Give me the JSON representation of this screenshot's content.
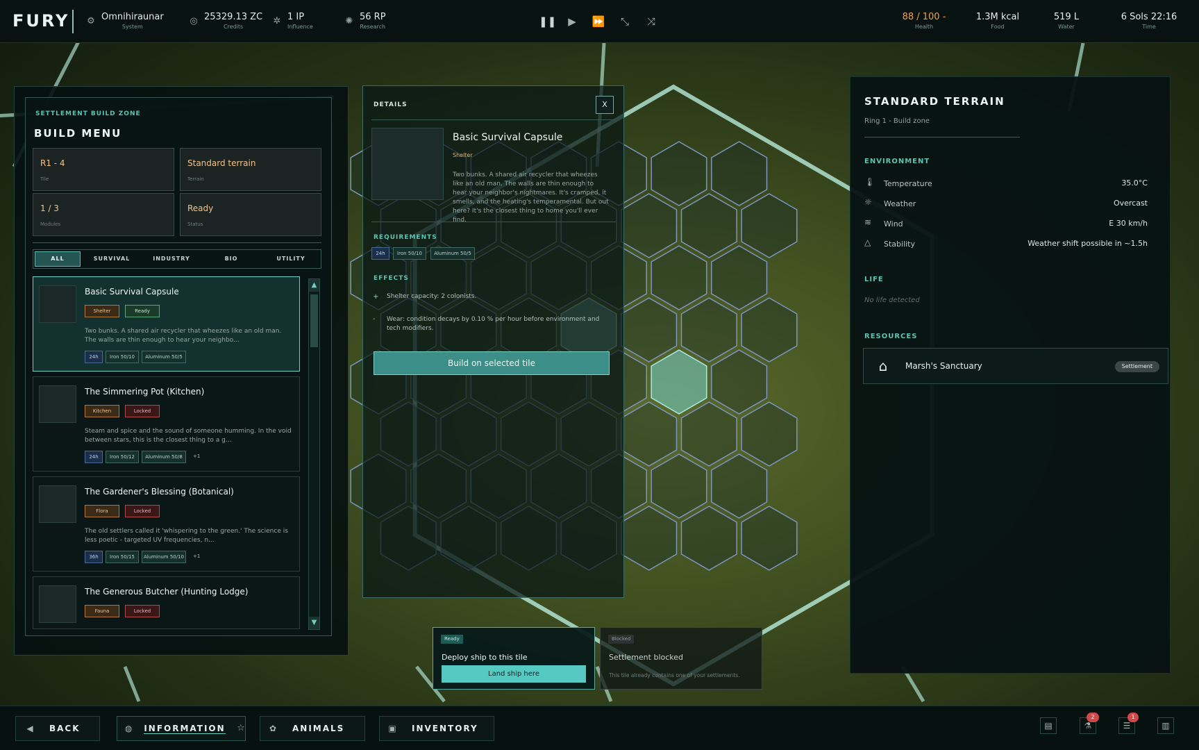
{
  "topbar": {
    "logo": "FURY",
    "stats": [
      {
        "icon": "system-icon",
        "value": "Omnihiraunar",
        "label": "System"
      },
      {
        "icon": "credits-icon",
        "value": "25329.13 ZC",
        "label": "Credits"
      },
      {
        "icon": "influence-icon",
        "value": "1 IP",
        "label": "Influence"
      },
      {
        "icon": "research-icon",
        "value": "56 RP",
        "label": "Research"
      }
    ],
    "resources": [
      {
        "value": "88 / 100 -",
        "label": "Health",
        "color": "#f0a34a"
      },
      {
        "value": "1.3M kcal",
        "label": "Food",
        "color": "#e6efec"
      },
      {
        "value": "519 L",
        "label": "Water",
        "color": "#e6efec"
      },
      {
        "value": "6 Sols 22:16",
        "label": "Time",
        "color": "#e6efec"
      }
    ],
    "speed_controls": [
      "pause-icon",
      "play-icon",
      "fast-forward-icon",
      "speed-3-icon",
      "speed-4-icon"
    ]
  },
  "build": {
    "kicker": "Settlement build zone",
    "title": "Build menu",
    "info": [
      {
        "value": "R1 - 4",
        "label": "Tile"
      },
      {
        "value": "Standard terrain",
        "label": "Terrain"
      },
      {
        "value": "1 / 3",
        "label": "Modules"
      },
      {
        "value": "Ready",
        "label": "Status"
      }
    ],
    "tabs": [
      "All",
      "Survival",
      "Industry",
      "Bio",
      "Utility"
    ],
    "cards": [
      {
        "name": "Basic Survival Capsule",
        "tags": [
          "Shelter",
          "Ready"
        ],
        "desc": "Two bunks. A shared air recycler that wheezes like an old man. The walls are thin enough to hear your neighbo...",
        "reqs": [
          "24h",
          "Iron 50/10",
          "Aluminum 50/5"
        ],
        "more": ""
      },
      {
        "name": "The Simmering Pot (Kitchen)",
        "tags": [
          "Kitchen",
          "Locked"
        ],
        "desc": "Steam and spice and the sound of someone humming. In the void between stars, this is the closest thing to a g...",
        "reqs": [
          "24h",
          "Iron 50/12",
          "Aluminum 50/8"
        ],
        "more": "+1"
      },
      {
        "name": "The Gardener's Blessing (Botanical)",
        "tags": [
          "Flora",
          "Locked"
        ],
        "desc": "The old settlers called it 'whispering to the green.' The science is less poetic - targeted UV frequencies, n...",
        "reqs": [
          "36h",
          "Iron 50/15",
          "Aluminum 50/10"
        ],
        "more": "+1"
      },
      {
        "name": "The Generous Butcher (Hunting Lodge)",
        "tags": [
          "Fauna",
          "Locked"
        ],
        "desc": "",
        "reqs": [],
        "more": ""
      }
    ]
  },
  "details": {
    "kicker": "Details",
    "close": "X",
    "name": "Basic Survival Capsule",
    "category": "Shelter",
    "desc": "Two bunks. A shared air recycler that wheezes like an old man. The walls are thin enough to hear your neighbor's nightmares. It's cramped, it smells, and the heating's temperamental. But out here? It's the closest thing to home you'll ever find.",
    "requirements_title": "Requirements",
    "requirements": [
      "24h",
      "Iron 50/10",
      "Aluminum 50/5"
    ],
    "effects_title": "Effects",
    "effects": [
      {
        "sign": "+",
        "text": "Shelter capacity: 2 colonists."
      },
      {
        "sign": "-",
        "text": "Wear: condition decays by 0.10 % per hour before environment and tech modifiers."
      }
    ],
    "build_button": "Build on selected tile"
  },
  "terrain": {
    "title": "Standard terrain",
    "subtitle": "Ring 1 - Build zone",
    "environment_title": "Environment",
    "environment": [
      {
        "icon": "thermometer-icon",
        "key": "Temperature",
        "value": "35.0°C"
      },
      {
        "icon": "weather-icon",
        "key": "Weather",
        "value": "Overcast"
      },
      {
        "icon": "wind-icon",
        "key": "Wind",
        "value": "E 30 km/h"
      },
      {
        "icon": "stability-icon",
        "key": "Stability",
        "value": "Weather shift possible in ~1.5h"
      }
    ],
    "life_title": "Life",
    "life_text": "No life detected",
    "resources_title": "Resources",
    "resource": {
      "name": "Marsh's Sanctuary",
      "tag": "Settlement"
    }
  },
  "actions": {
    "ready": {
      "badge": "Ready",
      "title": "Deploy ship to this tile",
      "button": "Land ship here"
    },
    "blocked": {
      "badge": "Blocked",
      "title": "Settlement blocked",
      "text": "This tile already contains one of your settlements."
    }
  },
  "bottombar": {
    "back": "Back",
    "information": "Information",
    "animals": "Animals",
    "inventory": "Inventory",
    "notifications": [
      "2",
      "1"
    ]
  }
}
